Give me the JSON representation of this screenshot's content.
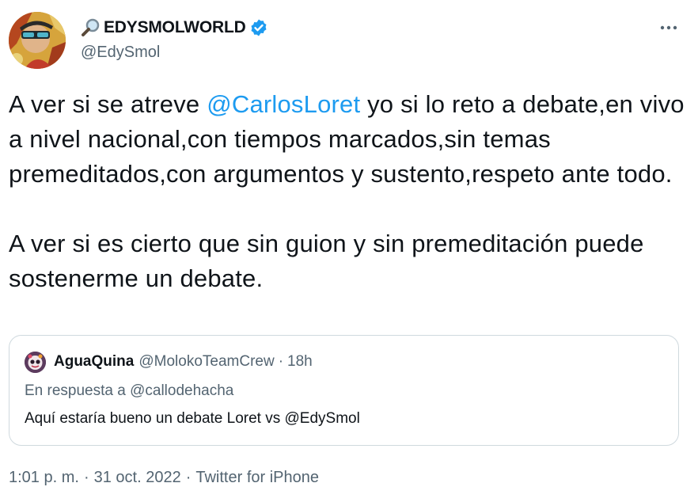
{
  "author": {
    "display_name": "EDYSMOLWORLD",
    "name_prefix_icon": "magnifying-glass-icon",
    "verified": true,
    "handle": "@EdySmol"
  },
  "tweet": {
    "text_part1": "A ver si se atreve ",
    "mention": "@CarlosLoret",
    "text_part2": " yo si lo reto a debate,en vivo a nivel nacional,con tiempos marcados,sin temas premeditados,con argumentos y sustento,respeto ante todo.\n\nA ver si es cierto que sin guion y sin premeditación puede sostenerme un debate."
  },
  "quoted_tweet": {
    "display_name": "AguaQuina",
    "handle": "@MolokoTeamCrew",
    "separator": "·",
    "time": "18h",
    "reply_prefix": "En respuesta a ",
    "reply_to": "@callodehacha",
    "text": "Aquí estaría bueno un debate Loret vs @EdySmol"
  },
  "meta": {
    "time": "1:01 p. m.",
    "separator": "·",
    "date": "31 oct. 2022",
    "source": "Twitter for iPhone"
  },
  "colors": {
    "accent": "#1d9bf0",
    "secondary_text": "#536471",
    "border": "#cfd9de",
    "primary_text": "#0f1419"
  }
}
